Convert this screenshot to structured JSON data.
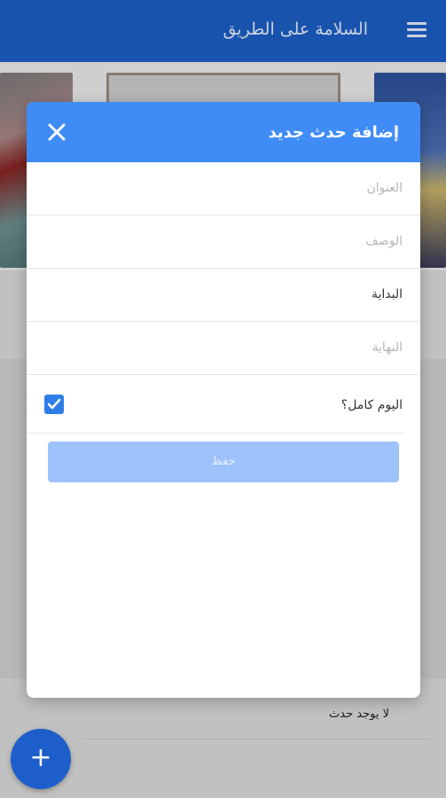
{
  "app": {
    "title": "السلامة على الطريق"
  },
  "background": {
    "empty_text": "لا يوجد حدث",
    "fab_label": "+"
  },
  "dialog": {
    "title": "إضافة حدث جديد",
    "fields": [
      {
        "label": "العنوان",
        "filled": false
      },
      {
        "label": "الوصف",
        "filled": false
      },
      {
        "label": "البداية",
        "filled": true
      },
      {
        "label": "النهاية",
        "filled": false
      }
    ],
    "all_day_label": "اليوم كامل؟",
    "all_day_checked": true,
    "save_label": "حفظ"
  },
  "colors": {
    "appbar": "#1c5fc7",
    "dialog_header": "#3f8cf6",
    "checkbox": "#2f7ee8",
    "save_button": "#9ec2fb"
  },
  "icons": {
    "menu": "menu-icon",
    "close": "close-icon",
    "check": "check-icon",
    "add": "plus-icon"
  }
}
